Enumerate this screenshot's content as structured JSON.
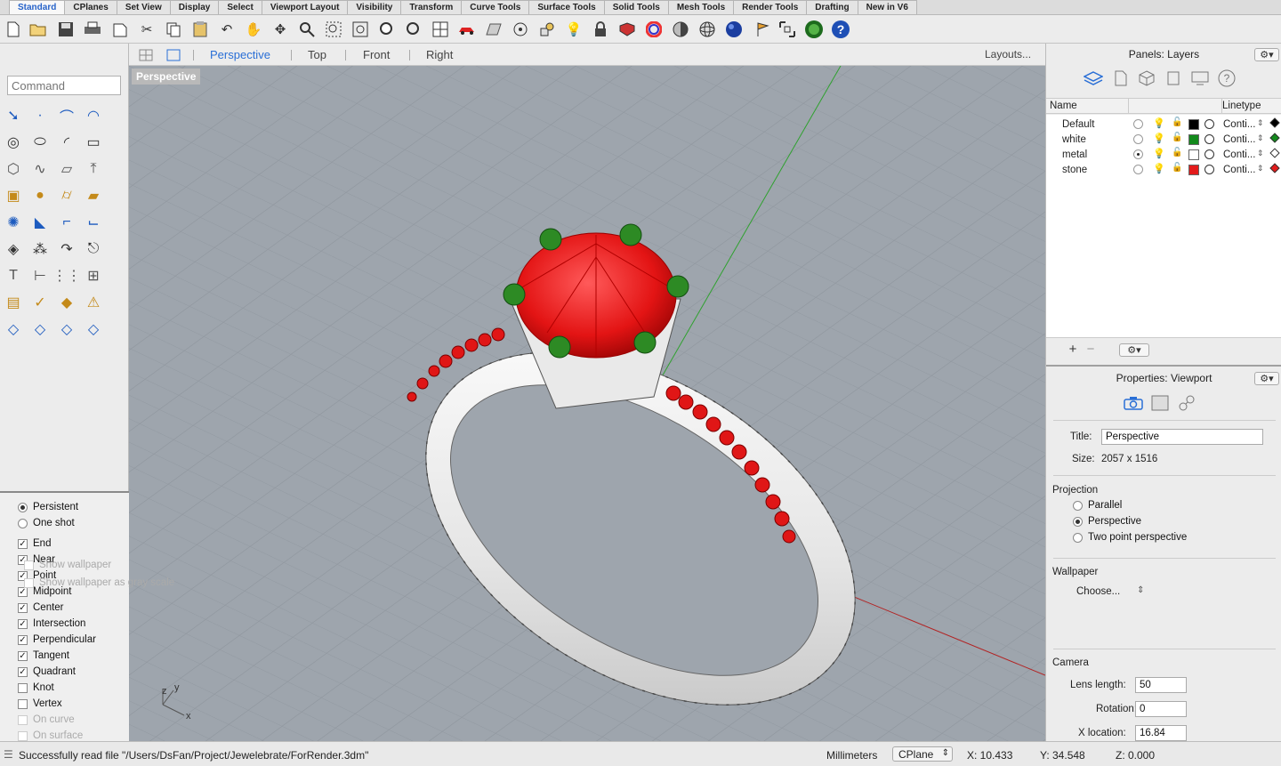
{
  "tabs": [
    "Standard",
    "CPlanes",
    "Set View",
    "Display",
    "Select",
    "Viewport Layout",
    "Visibility",
    "Transform",
    "Curve Tools",
    "Surface Tools",
    "Solid Tools",
    "Mesh Tools",
    "Render Tools",
    "Drafting",
    "New in V6"
  ],
  "active_tab": "Standard",
  "command": {
    "placeholder": "Command"
  },
  "viewport_tabs": {
    "perspective": "Perspective",
    "top": "Top",
    "front": "Front",
    "right": "Right",
    "layouts": "Layouts..."
  },
  "viewport": {
    "label": "Perspective",
    "axis_x": "x",
    "axis_y": "y",
    "axis_z": "z"
  },
  "osnap": {
    "modes": [
      {
        "label": "Persistent",
        "selected": true
      },
      {
        "label": "One shot",
        "selected": false
      }
    ],
    "items": [
      {
        "label": "End",
        "checked": true,
        "enabled": true
      },
      {
        "label": "Near",
        "checked": true,
        "enabled": true
      },
      {
        "label": "Point",
        "checked": true,
        "enabled": true
      },
      {
        "label": "Midpoint",
        "checked": true,
        "enabled": true
      },
      {
        "label": "Center",
        "checked": true,
        "enabled": true
      },
      {
        "label": "Intersection",
        "checked": true,
        "enabled": true
      },
      {
        "label": "Perpendicular",
        "checked": true,
        "enabled": true
      },
      {
        "label": "Tangent",
        "checked": true,
        "enabled": true
      },
      {
        "label": "Quadrant",
        "checked": true,
        "enabled": true
      },
      {
        "label": "Knot",
        "checked": false,
        "enabled": true
      },
      {
        "label": "Vertex",
        "checked": false,
        "enabled": true
      },
      {
        "label": "On curve",
        "checked": false,
        "enabled": false
      },
      {
        "label": "On surface",
        "checked": false,
        "enabled": false
      }
    ]
  },
  "layers_panel": {
    "title": "Panels: Layers",
    "col_name": "Name",
    "col_linetype": "Linetype",
    "layers": [
      {
        "name": "Default",
        "color": "#000000",
        "linetype": "Conti...",
        "current": false
      },
      {
        "name": "white",
        "color": "#138a1c",
        "linetype": "Conti...",
        "current": false
      },
      {
        "name": "metal",
        "color": "#ffffff",
        "linetype": "Conti...",
        "current": true
      },
      {
        "name": "stone",
        "color": "#e31b1b",
        "linetype": "Conti...",
        "current": false
      }
    ]
  },
  "properties_panel": {
    "title": "Properties: Viewport",
    "title_label": "Title:",
    "title_value": "Perspective",
    "size_label": "Size:",
    "size_value": "2057 x 1516",
    "projection_heading": "Projection",
    "projection_options": [
      {
        "label": "Parallel",
        "selected": false
      },
      {
        "label": "Perspective",
        "selected": true
      },
      {
        "label": "Two point perspective",
        "selected": false
      }
    ],
    "wallpaper_heading": "Wallpaper",
    "wallpaper_choose": "Choose...",
    "show_wallpaper": "Show wallpaper",
    "show_gray": "Show wallpaper as gray scale",
    "camera_heading": "Camera",
    "lens_label": "Lens length:",
    "lens_value": "50",
    "rotation_label": "Rotation:",
    "rotation_value": "0",
    "xloc_label": "X location:",
    "xloc_value": "16.84"
  },
  "status": {
    "message": "Successfully read file \"/Users/DsFan/Project/Jewelebrate/ForRender.3dm\"",
    "units": "Millimeters",
    "cplane": "CPlane",
    "x": "X: 10.433",
    "y": "Y: 34.548",
    "z": "Z: 0.000"
  },
  "colors": {
    "accent": "#2a6fd6",
    "viewport_bg": "#9ea5ad",
    "stone": "#e41616",
    "prong": "#2d8a24",
    "metal": "#f2f2f2"
  }
}
